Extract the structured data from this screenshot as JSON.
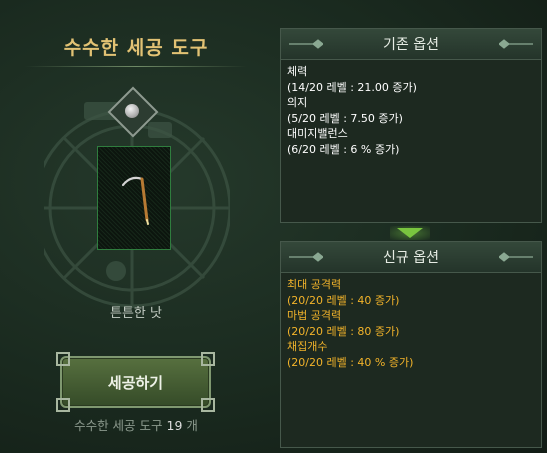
{
  "left": {
    "title": "수수한 세공 도구",
    "item_name": "튼튼한 낫",
    "craft_button": "세공하기",
    "count": {
      "prefix": "수수한 세공 도구",
      "number": "19",
      "suffix": "개"
    },
    "slot_item_icon": "sickle-icon",
    "emblem_gem_icon": "gem-icon"
  },
  "base_options": {
    "header": "기존 옵션",
    "lines": [
      "체력",
      "(14/20 레벨 : 21.00 증가)",
      "의지",
      "(5/20 레벨 : 7.50 증가)",
      "대미지밸런스",
      "(6/20 레벨 : 6 % 증가)"
    ]
  },
  "new_options": {
    "header": "신규 옵션",
    "lines": [
      "최대 공격력",
      "(20/20 레벨 : 40 증가)",
      "마법 공격력",
      "(20/20 레벨 : 80 증가)",
      "채집개수",
      "(20/20 레벨 : 40 % 증가)"
    ]
  },
  "colors": {
    "title": "#e2c274",
    "new_option_text": "#f2b32a",
    "arrow": "#79c53f"
  }
}
